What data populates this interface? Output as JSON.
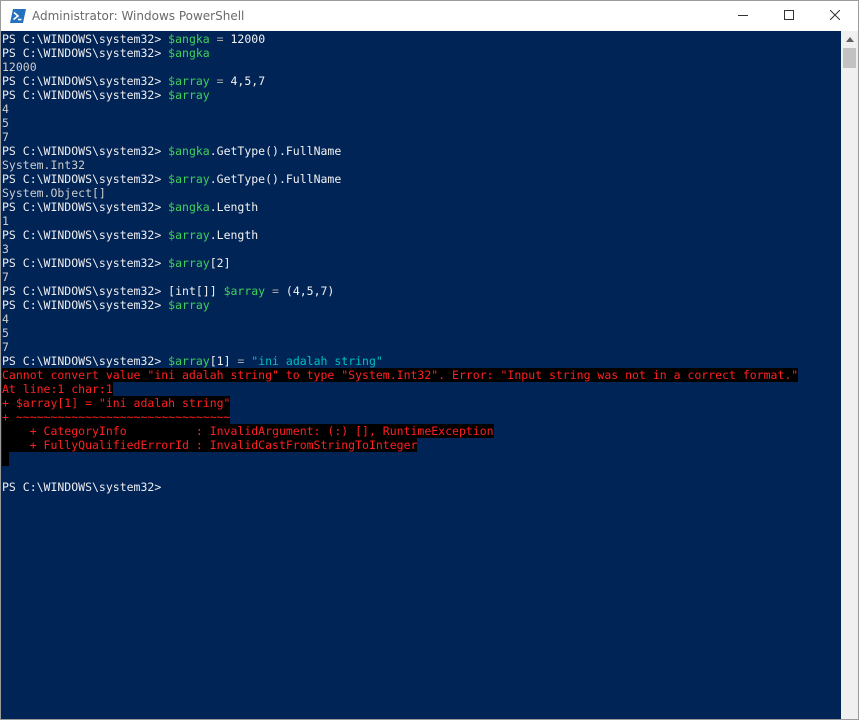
{
  "window": {
    "title": "Administrator: Windows PowerShell",
    "icon": "powershell-icon",
    "controls": {
      "minimize": "minimize-icon",
      "maximize": "maximize-icon",
      "close": "close-icon"
    }
  },
  "colors": {
    "console_bg": "#012456",
    "variable": "#3fd15b",
    "string": "#00bfbf",
    "error_fg": "#ff2020",
    "error_bg": "#000000"
  },
  "console": {
    "prompt": "PS C:\\WINDOWS\\system32> ",
    "lines": [
      {
        "kind": "prompt",
        "parts": [
          {
            "t": "var",
            "v": "$angka"
          },
          {
            "t": "op",
            "v": " = "
          },
          {
            "t": "cmd",
            "v": "12000"
          }
        ]
      },
      {
        "kind": "prompt",
        "parts": [
          {
            "t": "var",
            "v": "$angka"
          }
        ]
      },
      {
        "kind": "out",
        "text": "12000"
      },
      {
        "kind": "prompt",
        "parts": [
          {
            "t": "var",
            "v": "$array"
          },
          {
            "t": "op",
            "v": " = "
          },
          {
            "t": "cmd",
            "v": "4,5,7"
          }
        ]
      },
      {
        "kind": "prompt",
        "parts": [
          {
            "t": "var",
            "v": "$array"
          }
        ]
      },
      {
        "kind": "out",
        "text": "4"
      },
      {
        "kind": "out",
        "text": "5"
      },
      {
        "kind": "out",
        "text": "7"
      },
      {
        "kind": "prompt",
        "parts": [
          {
            "t": "var",
            "v": "$angka"
          },
          {
            "t": "cmd",
            "v": ".GetType().FullName"
          }
        ]
      },
      {
        "kind": "out",
        "text": "System.Int32"
      },
      {
        "kind": "prompt",
        "parts": [
          {
            "t": "var",
            "v": "$array"
          },
          {
            "t": "cmd",
            "v": ".GetType().FullName"
          }
        ]
      },
      {
        "kind": "out",
        "text": "System.Object[]"
      },
      {
        "kind": "prompt",
        "parts": [
          {
            "t": "var",
            "v": "$angka"
          },
          {
            "t": "cmd",
            "v": ".Length"
          }
        ]
      },
      {
        "kind": "out",
        "text": "1"
      },
      {
        "kind": "prompt",
        "parts": [
          {
            "t": "var",
            "v": "$array"
          },
          {
            "t": "cmd",
            "v": ".Length"
          }
        ]
      },
      {
        "kind": "out",
        "text": "3"
      },
      {
        "kind": "prompt",
        "parts": [
          {
            "t": "var",
            "v": "$array"
          },
          {
            "t": "cmd",
            "v": "[2]"
          }
        ]
      },
      {
        "kind": "out",
        "text": "7"
      },
      {
        "kind": "prompt",
        "parts": [
          {
            "t": "cmd",
            "v": "[int[]] "
          },
          {
            "t": "var",
            "v": "$array"
          },
          {
            "t": "op",
            "v": " = "
          },
          {
            "t": "cmd",
            "v": "(4,5,7)"
          }
        ]
      },
      {
        "kind": "prompt",
        "parts": [
          {
            "t": "var",
            "v": "$array"
          }
        ]
      },
      {
        "kind": "out",
        "text": "4"
      },
      {
        "kind": "out",
        "text": "5"
      },
      {
        "kind": "out",
        "text": "7"
      },
      {
        "kind": "prompt",
        "parts": [
          {
            "t": "var",
            "v": "$array"
          },
          {
            "t": "cmd",
            "v": "[1]"
          },
          {
            "t": "op",
            "v": " = "
          },
          {
            "t": "str",
            "v": "\"ini adalah string\""
          }
        ]
      },
      {
        "kind": "err",
        "text": "Cannot convert value \"ini adalah string\" to type \"System.Int32\". Error: \"Input string was not in a correct format.\""
      },
      {
        "kind": "err",
        "text": "At line:1 char:1"
      },
      {
        "kind": "err",
        "text": "+ $array[1] = \"ini adalah string\""
      },
      {
        "kind": "err",
        "text": "+ ~~~~~~~~~~~~~~~~~~~~~~~~~~~~~~~"
      },
      {
        "kind": "err",
        "text": "    + CategoryInfo          : InvalidArgument: (:) [], RuntimeException"
      },
      {
        "kind": "err",
        "text": "    + FullyQualifiedErrorId : InvalidCastFromStringToInteger"
      },
      {
        "kind": "err",
        "text": " "
      },
      {
        "kind": "out",
        "text": ""
      },
      {
        "kind": "prompt",
        "parts": []
      }
    ]
  },
  "scrollbar": {
    "up_icon": "scroll-up-arrow-icon"
  }
}
